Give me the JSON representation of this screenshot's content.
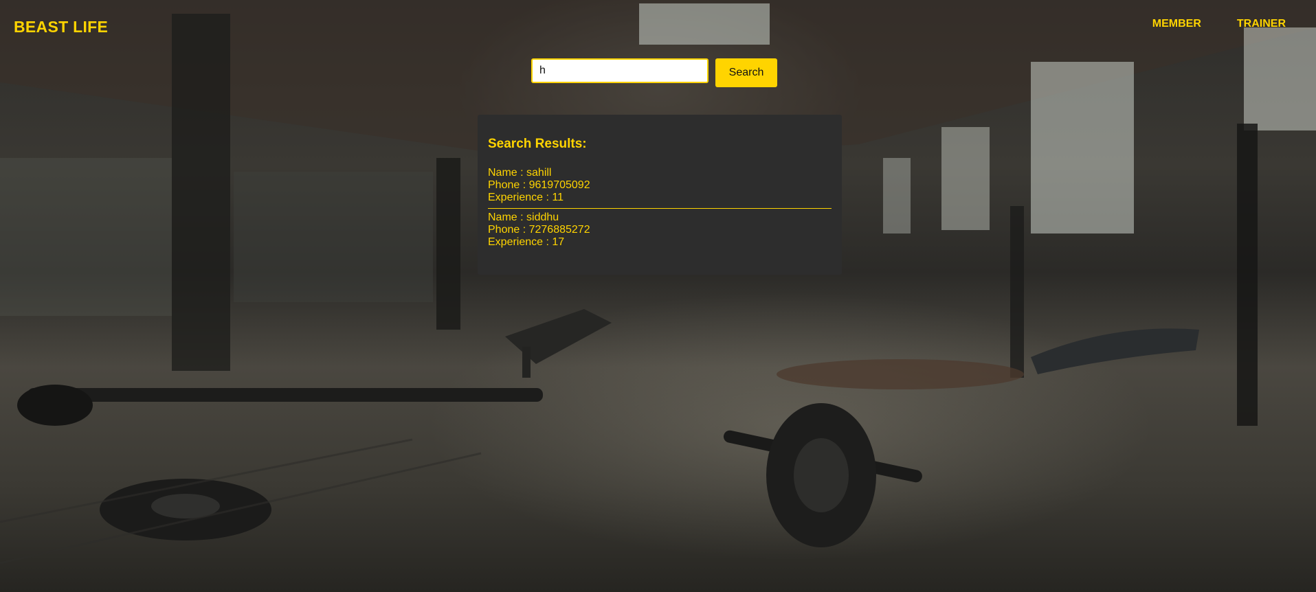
{
  "header": {
    "brand": "BEAST LIFE",
    "nav": [
      {
        "label": "MEMBER"
      },
      {
        "label": "TRAINER"
      }
    ]
  },
  "search": {
    "value": "h",
    "button_label": "Search"
  },
  "results": {
    "title": "Search Results:",
    "items": [
      {
        "name": "Name : sahill",
        "phone": "Phone : 9619705092",
        "experience": "Experience : 11"
      },
      {
        "name": "Name : siddhu",
        "phone": "Phone : 7276885272",
        "experience": "Experience : 17"
      }
    ]
  },
  "colors": {
    "accent": "#ffd400",
    "panel": "#2d2d2d"
  }
}
